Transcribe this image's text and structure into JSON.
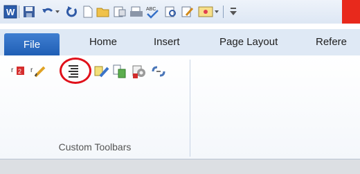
{
  "quick_access_toolbar": {
    "buttons": [
      "word-app-icon",
      "save-icon",
      "undo-icon",
      "undo-dropdown-icon",
      "redo-icon",
      "new-document-icon",
      "open-folder-icon",
      "page-setup-icon",
      "print-preview-icon",
      "spelling-check-icon",
      "print-preview-zoom-icon",
      "edit-document-icon",
      "insert-picture-icon",
      "customize-dropdown-icon"
    ]
  },
  "tabs": [
    {
      "label": "File"
    },
    {
      "label": "Home"
    },
    {
      "label": "Insert"
    },
    {
      "label": "Page Layout"
    },
    {
      "label": "Refere"
    }
  ],
  "ribbon": {
    "group_label": "Custom Toolbars",
    "buttons": [
      "macro-icon-1",
      "macro-pencil-icon",
      "paragraph-lines-icon",
      "highlight-pencil-icon",
      "replace-icon",
      "settings-icon",
      "link-break-icon"
    ]
  },
  "colors": {
    "file_tab": "#2a6bc2",
    "highlight_circle": "#e0101a",
    "title_red": "#e8291c"
  }
}
